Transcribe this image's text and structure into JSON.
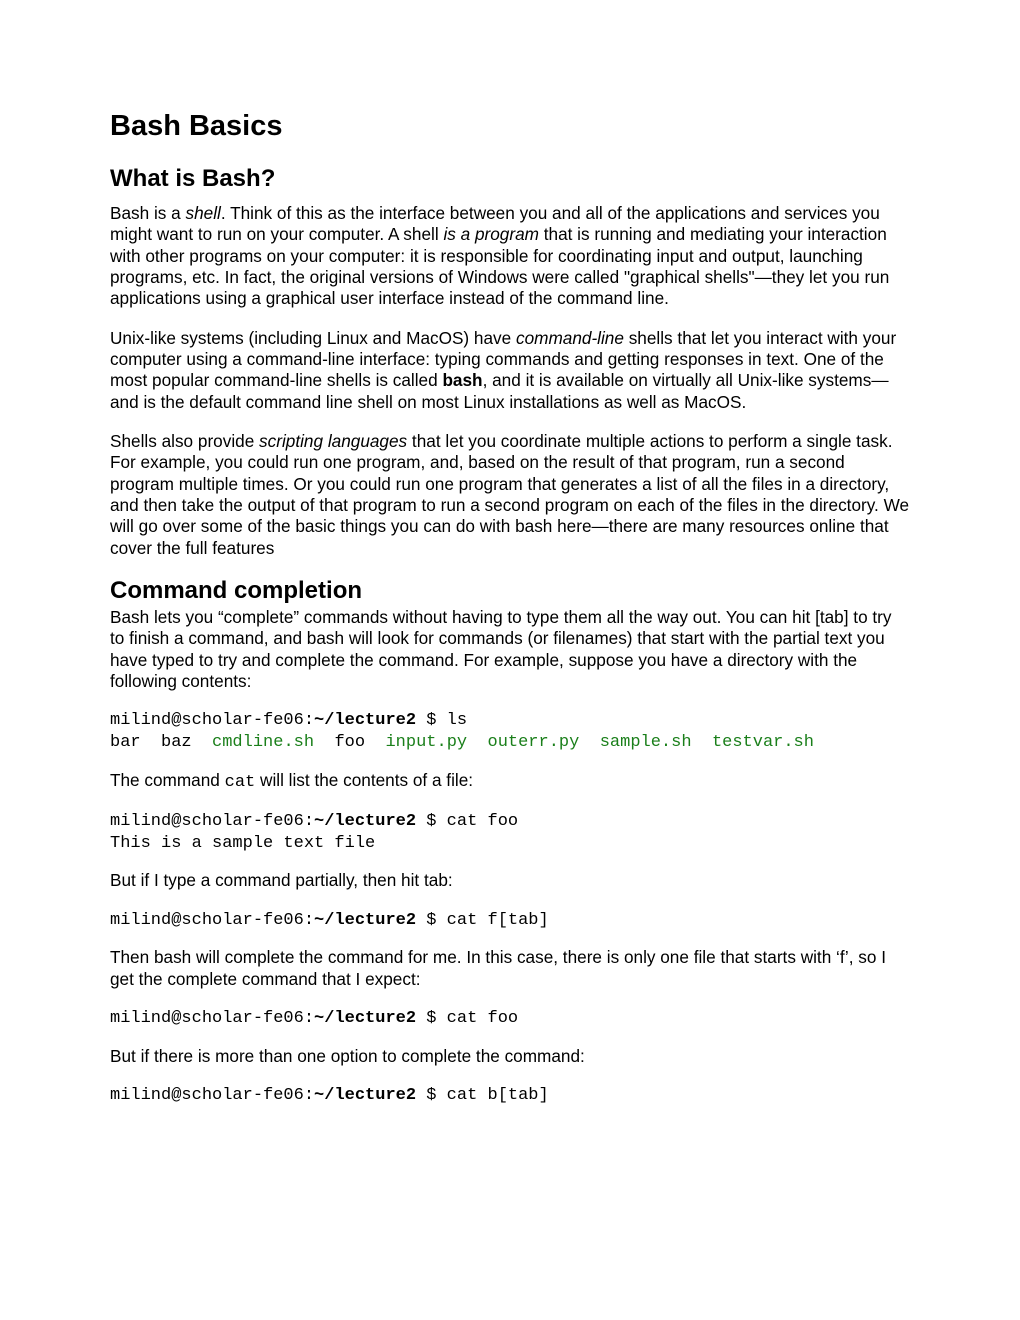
{
  "title": "Bash Basics",
  "section1": {
    "heading": "What is Bash?",
    "p1_a": "Bash is a ",
    "p1_b": "shell",
    "p1_c": ". Think of this as the interface between you and all of the applications and services you might want to run on your computer. A shell ",
    "p1_d": "is a program",
    "p1_e": " that is running and mediating your interaction with other programs on your computer: it is responsible for coordinating input and output, launching programs, etc. In fact, the original versions of Windows were called \"graphical shells\"—they let you run applications using a graphical user interface instead of the command line.",
    "p2_a": "Unix-like systems (including Linux and MacOS) have ",
    "p2_b": "command-line",
    "p2_c": " shells that let you interact with your computer using a command-line interface: typing commands and getting responses in text. One of the most popular command-line shells is called ",
    "p2_d": "bash",
    "p2_e": ", and it is available on virtually all Unix-like systems—and is the default command line shell on most Linux installations as well as MacOS.",
    "p3_a": "Shells also provide ",
    "p3_b": "scripting languages",
    "p3_c": " that let you coordinate multiple actions to perform a single task. For example, you could run one program, and, based on the result of that program, run a second program multiple times. Or you could run one program that generates a list of all the files in a directory, and then take the output of that program to run a second program on each of the files in the directory. We will go over some of the basic things you can do with bash here—there are many resources online that cover the full features"
  },
  "section2": {
    "heading": "Command completion",
    "p1": "Bash lets you “complete” commands without having to type them all the way out. You can hit [tab] to try to finish a command, and bash will look for commands (or filenames) that start with the partial text you have typed to try and complete the command. For example, suppose you have a directory with the following contents:",
    "code1_prompt_a": "milind@scholar-fe06:",
    "code1_prompt_b": "~/lecture2",
    "code1_prompt_c": " $ ls",
    "code1_files_a": "bar  baz  ",
    "code1_files_b": "cmdline.sh",
    "code1_files_c": "  foo  ",
    "code1_files_d": "input.py  outerr.py  sample.sh  testvar.sh",
    "p2a": "The command ",
    "p2b": "cat",
    "p2c": " will list the contents of a file:",
    "code2_a": "milind@scholar-fe06:",
    "code2_b": "~/lecture2",
    "code2_c": " $ cat foo",
    "code2_d": "This is a sample text file",
    "p3": "But if I type a command partially, then hit tab:",
    "code3_a": "milind@scholar-fe06:",
    "code3_b": "~/lecture2",
    "code3_c": " $ cat f[tab]",
    "p4": "Then bash will complete the command for me. In this case, there is only one file that starts with ‘f’, so I get the complete command that I expect:",
    "code4_a": "milind@scholar-fe06:",
    "code4_b": "~/lecture2",
    "code4_c": " $ cat foo",
    "p5": "But if there is more than one option to complete the command:",
    "code5_a": "milind@scholar-fe06:",
    "code5_b": "~/lecture2",
    "code5_c": " $ cat b[tab]"
  }
}
